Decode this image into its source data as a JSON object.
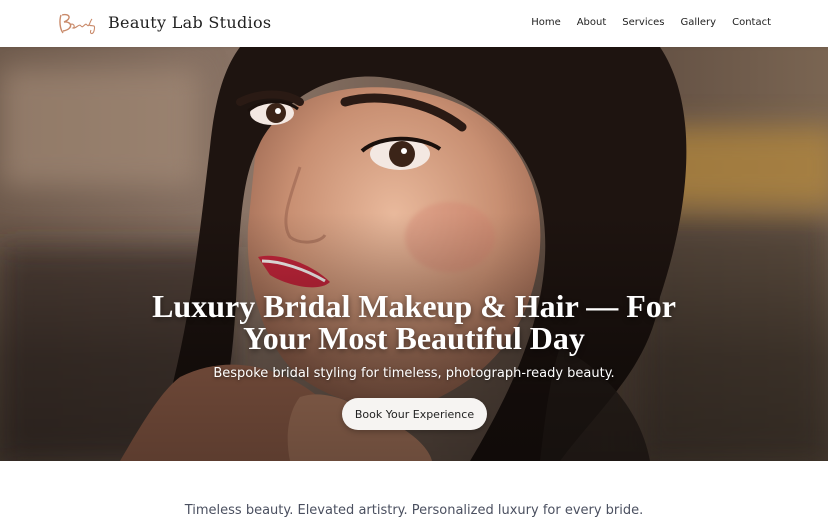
{
  "header": {
    "brand": "Beauty Lab Studios",
    "logo_icon": "beauty-script-logo",
    "nav": [
      "Home",
      "About",
      "Services",
      "Gallery",
      "Contact"
    ]
  },
  "hero": {
    "title_line1": "Luxury Bridal Makeup & Hair — For",
    "title_line2": "Your Most Beautiful Day",
    "subtitle": "Bespoke bridal styling for timeless, photograph-ready beauty.",
    "cta_label": "Book Your Experience"
  },
  "intro": {
    "tagline": "Timeless beauty. Elevated artistry. Personalized luxury for every bride."
  },
  "colors": {
    "header_bg": "#ffffff",
    "cta_bg": "#f6f4f2",
    "text": "#222222",
    "tagline": "#4b5060"
  }
}
